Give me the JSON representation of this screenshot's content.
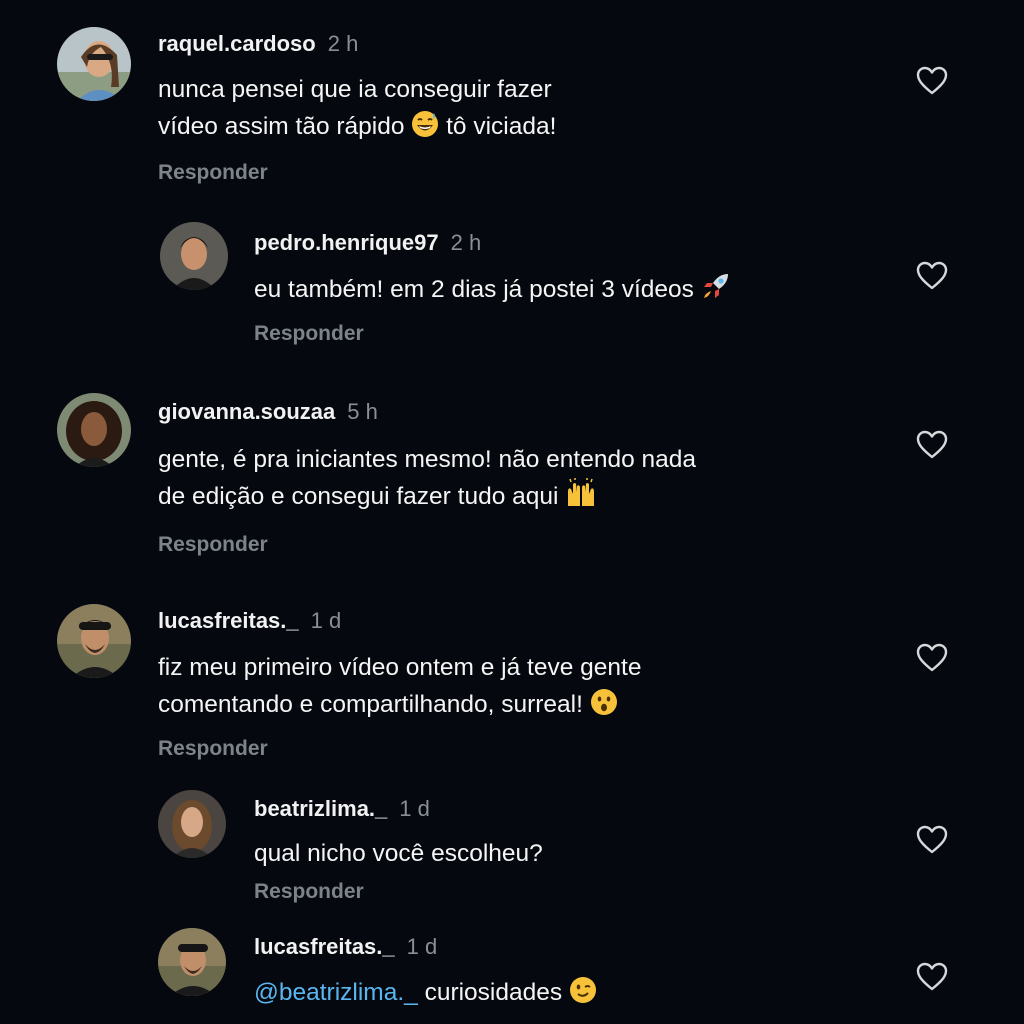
{
  "comments": [
    {
      "username": "raquel.cardoso",
      "time": "2 h",
      "line1": "nunca pensei que ia conseguir fazer",
      "line2_a": "vídeo assim tão rápido",
      "line2_b": "tô viciada!",
      "emoji": "grinning-sweat-emoji",
      "reply_label": "Responder",
      "liked": false
    },
    {
      "username": "pedro.henrique97",
      "time": "2 h",
      "line1": "eu também! em 2 dias já postei 3 vídeos",
      "emoji": "rocket-emoji",
      "reply_label": "Responder",
      "liked": false
    },
    {
      "username": "giovanna.souzaa",
      "time": "5 h",
      "line1": "gente, é pra iniciantes mesmo! não entendo nada",
      "line2_a": "de edição e consegui fazer tudo aqui",
      "emoji": "raising-hands-emoji",
      "reply_label": "Responder",
      "liked": false
    },
    {
      "username": "lucasfreitas._",
      "time": "1 d",
      "line1": "fiz meu primeiro vídeo ontem e já teve gente",
      "line2_a": "comentando e compartilhando, surreal!",
      "emoji": "astonished-face-emoji",
      "reply_label": "Responder",
      "liked": false
    },
    {
      "username": "beatrizlima._",
      "time": "1 d",
      "line1": "qual nicho você escolheu?",
      "reply_label": "Responder",
      "liked": false
    },
    {
      "username": "lucasfreitas._",
      "time": "1 d",
      "mention": "@beatrizlima._",
      "line1": "curiosidades",
      "emoji": "winking-face-emoji",
      "liked": false
    }
  ],
  "colors": {
    "background": "#05090f",
    "mention": "#5ab6f0",
    "muted": "#8a8f96"
  }
}
